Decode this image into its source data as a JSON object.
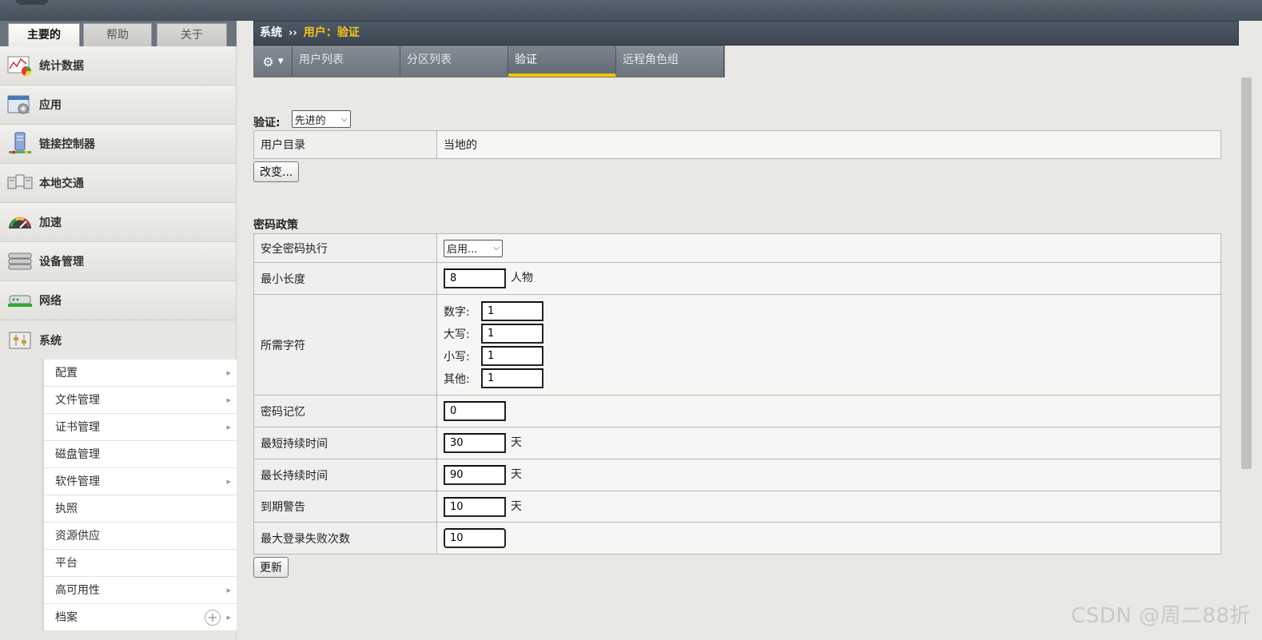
{
  "top_tabs": [
    "主要的",
    "帮助",
    "关于"
  ],
  "nav": [
    {
      "label": "统计数据",
      "icon": "statistics-icon"
    },
    {
      "label": "应用",
      "icon": "application-icon"
    },
    {
      "label": "链接控制器",
      "icon": "link-controller-icon"
    },
    {
      "label": "本地交通",
      "icon": "local-traffic-icon"
    },
    {
      "label": "加速",
      "icon": "acceleration-icon"
    },
    {
      "label": "设备管理",
      "icon": "device-management-icon"
    },
    {
      "label": "网络",
      "icon": "network-icon"
    },
    {
      "label": "系统",
      "icon": "system-icon"
    }
  ],
  "submenu": [
    {
      "label": "配置",
      "arrow": true
    },
    {
      "label": "文件管理",
      "arrow": true
    },
    {
      "label": "证书管理",
      "arrow": true
    },
    {
      "label": "磁盘管理",
      "arrow": false
    },
    {
      "label": "软件管理",
      "arrow": true
    },
    {
      "label": "执照",
      "arrow": false
    },
    {
      "label": "资源供应",
      "arrow": false
    },
    {
      "label": "平台",
      "arrow": false
    },
    {
      "label": "高可用性",
      "arrow": true
    },
    {
      "label": "档案",
      "arrow": true,
      "plus": true
    }
  ],
  "breadcrumb": {
    "root": "系统",
    "sep": "››",
    "current": "用户：验证"
  },
  "content_tabs": [
    "用户列表",
    "分区列表",
    "验证",
    "远程角色组"
  ],
  "auth": {
    "label": "验证:",
    "select_value": "先进的",
    "user_dir_label": "用户目录",
    "user_dir_value": "当地的",
    "change_button": "改变..."
  },
  "password_policy": {
    "title": "密码政策",
    "secure_enforce_label": "安全密码执行",
    "secure_enforce_value": "启用...",
    "min_length_label": "最小长度",
    "min_length_value": "8",
    "min_length_unit": "人物",
    "required_chars_label": "所需字符",
    "digits_label": "数字:",
    "digits_value": "1",
    "upper_label": "大写:",
    "upper_value": "1",
    "lower_label": "小写:",
    "lower_value": "1",
    "other_label": "其他:",
    "other_value": "1",
    "memory_label": "密码记忆",
    "memory_value": "0",
    "min_duration_label": "最短持续时间",
    "min_duration_value": "30",
    "max_duration_label": "最长持续时间",
    "max_duration_value": "90",
    "expiry_label": "到期警告",
    "expiry_value": "10",
    "max_fail_label": "最大登录失败次数",
    "max_fail_value": "10",
    "day_unit": "天",
    "update_button": "更新"
  },
  "watermark": "CSDN @周二88折"
}
